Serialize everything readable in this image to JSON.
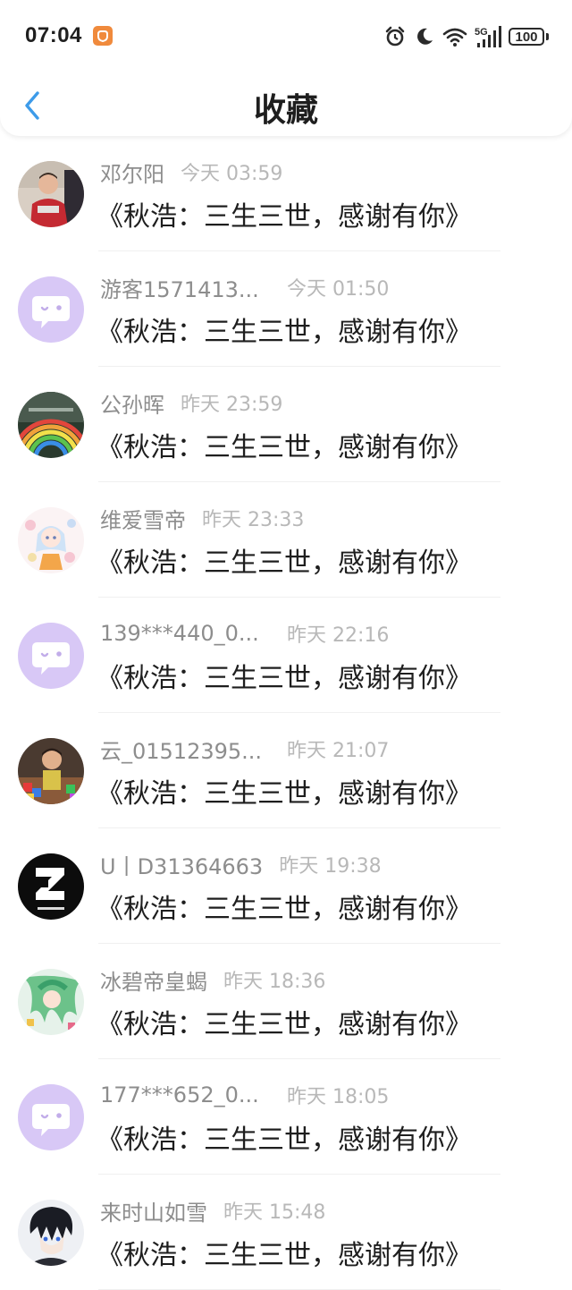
{
  "status_bar": {
    "time": "07:04",
    "battery": "100",
    "network": "5G"
  },
  "header": {
    "title": "收藏",
    "back_icon": "chevron-left-icon"
  },
  "colors": {
    "accent": "#3d9be9",
    "default_avatar_bg": "#d8c8f6",
    "default_avatar_bubble": "#ffffff"
  },
  "items": [
    {
      "name": "邓尔阳",
      "time": "今天 03:59",
      "title": "《秋浩：三生三世，感谢有你》",
      "avatar": "photo-child-red"
    },
    {
      "name": "游客1571413...",
      "time": "今天 01:50",
      "title": "《秋浩：三生三世，感谢有你》",
      "avatar": "default-chat-bubble"
    },
    {
      "name": "公孙晖",
      "time": "昨天 23:59",
      "title": "《秋浩：三生三世，感谢有你》",
      "avatar": "photo-rainbow"
    },
    {
      "name": "维爱雪帝",
      "time": "昨天 23:33",
      "title": "《秋浩：三生三世，感谢有你》",
      "avatar": "anime-girl-pastel"
    },
    {
      "name": "139***440_0...",
      "time": "昨天 22:16",
      "title": "《秋浩：三生三世，感谢有你》",
      "avatar": "default-chat-bubble"
    },
    {
      "name": "云_01512395...",
      "time": "昨天 21:07",
      "title": "《秋浩：三生三世，感谢有你》",
      "avatar": "photo-child-toys"
    },
    {
      "name": "U丨D31364663",
      "time": "昨天 19:38",
      "title": "《秋浩：三生三世，感谢有你》",
      "avatar": "black-logo"
    },
    {
      "name": "冰碧帝皇蝎",
      "time": "昨天 18:36",
      "title": "《秋浩：三生三世，感谢有你》",
      "avatar": "anime-green-hair"
    },
    {
      "name": "177***652_0...",
      "time": "昨天 18:05",
      "title": "《秋浩：三生三世，感谢有你》",
      "avatar": "default-chat-bubble"
    },
    {
      "name": "来时山如雪",
      "time": "昨天 15:48",
      "title": "《秋浩：三生三世，感谢有你》",
      "avatar": "anime-dark-boy"
    }
  ]
}
